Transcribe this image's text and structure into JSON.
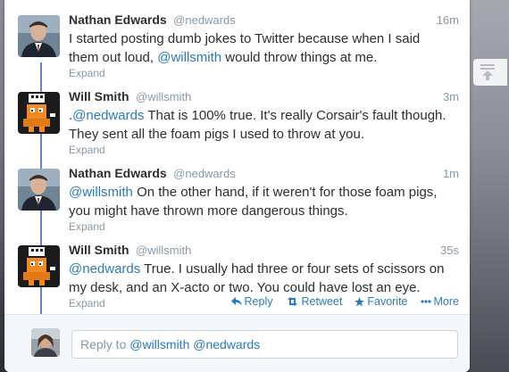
{
  "tweets": [
    {
      "name": "Nathan Edwards",
      "handle": "@nedwards",
      "time": "16m",
      "text_before": "I started posting dumb jokes to Twitter because when I said them out loud, ",
      "mention": "@willsmith",
      "text_after": " would throw things at me.",
      "expand": "Expand"
    },
    {
      "name": "Will Smith",
      "handle": "@willsmith",
      "time": "3m",
      "text_before": ".",
      "mention": "@nedwards",
      "text_after": " That is 100% true. It's really Corsair's fault though. They sent all the foam pigs I used to throw at you.",
      "expand": "Expand"
    },
    {
      "name": "Nathan Edwards",
      "handle": "@nedwards",
      "time": "1m",
      "text_before": "",
      "mention": "@willsmith",
      "text_after": " On the other hand, if it weren't for those foam pigs, you might have thrown more dangerous things.",
      "expand": "Expand"
    },
    {
      "name": "Will Smith",
      "handle": "@willsmith",
      "time": "35s",
      "text_before": "",
      "mention": "@nedwards",
      "text_after": " True. I usually had three or four sets of scissors on my desk, and an X-acto or two. You could have lost an eye.",
      "expand": "Expand"
    }
  ],
  "actions": {
    "reply": "Reply",
    "retweet": "Retweet",
    "favorite": "Favorite",
    "more": "More"
  },
  "reply_box": {
    "prefix": "Reply to ",
    "mentions": "@willsmith @nedwards"
  },
  "colors": {
    "link": "#2b7bb9",
    "thread_line": "#6b7fd9",
    "muted": "#8899a6"
  },
  "icons": {
    "avatar_will": "orange-pixel-robot",
    "floater": "compose-tray-icon"
  }
}
